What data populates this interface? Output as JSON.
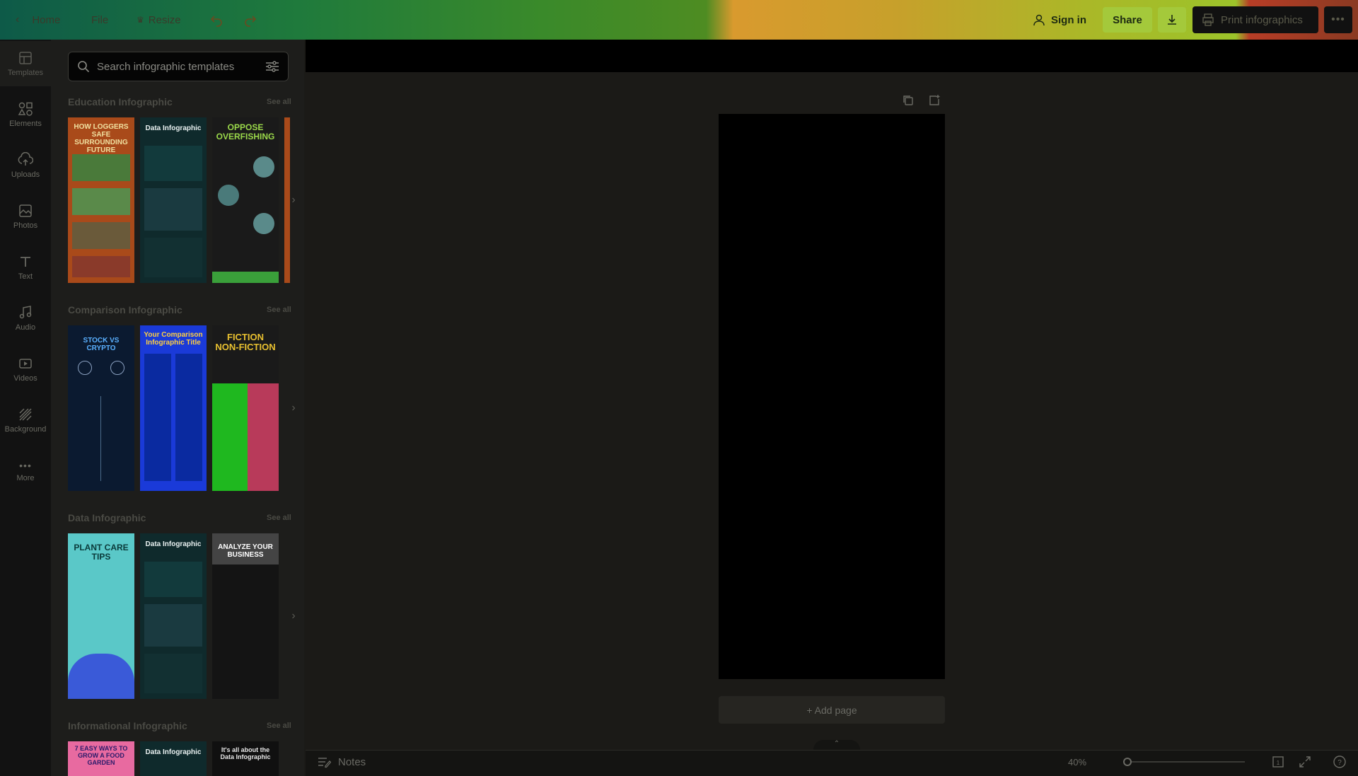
{
  "topbar": {
    "home": "Home",
    "file": "File",
    "resize": "Resize",
    "sign_in": "Sign in",
    "share": "Share",
    "print": "Print infographics"
  },
  "rail": {
    "items": [
      {
        "label": "Templates",
        "icon": "templates-icon"
      },
      {
        "label": "Elements",
        "icon": "elements-icon"
      },
      {
        "label": "Uploads",
        "icon": "uploads-icon"
      },
      {
        "label": "Photos",
        "icon": "photos-icon"
      },
      {
        "label": "Text",
        "icon": "text-icon"
      },
      {
        "label": "Audio",
        "icon": "audio-icon"
      },
      {
        "label": "Videos",
        "icon": "videos-icon"
      },
      {
        "label": "Background",
        "icon": "background-icon"
      },
      {
        "label": "More",
        "icon": "more-icon"
      }
    ]
  },
  "panel": {
    "search_placeholder": "Search infographic templates",
    "see_all": "See all",
    "sections": [
      {
        "title": "Education Infographic",
        "thumbs": [
          "HOW LOGGERS SAFE SURROUNDING FUTURE",
          "Data Infographic",
          "OPPOSE OVERFISHING"
        ]
      },
      {
        "title": "Comparison Infographic",
        "thumbs": [
          "STOCK VS CRYPTO",
          "Your Comparison Infographic Title",
          "FICTION NON-FICTION"
        ]
      },
      {
        "title": "Data Infographic",
        "thumbs": [
          "PLANT CARE TIPS",
          "Data Infographic",
          "ANALYZE YOUR BUSINESS"
        ]
      },
      {
        "title": "Informational Infographic",
        "thumbs": [
          "7 EASY WAYS TO GROW A FOOD GARDEN",
          "Data Infographic",
          "It's all about the Data Infographic"
        ]
      }
    ]
  },
  "canvas": {
    "add_page": "+ Add page"
  },
  "bottombar": {
    "notes": "Notes",
    "zoom": "40%"
  },
  "colors": {
    "share_bg": "#a4c93b",
    "print_bg": "#111111"
  }
}
